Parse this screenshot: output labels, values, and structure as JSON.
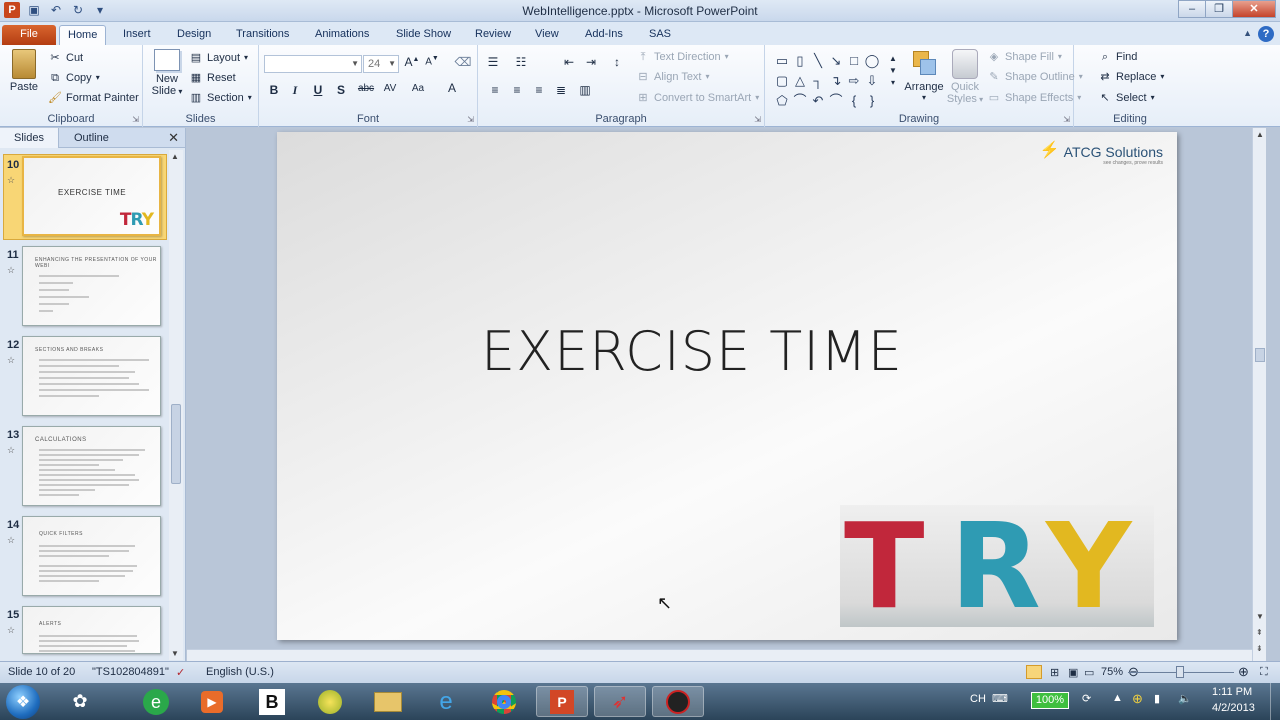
{
  "window": {
    "title": "WebIntelligence.pptx - Microsoft PowerPoint"
  },
  "tabs": [
    "File",
    "Home",
    "Insert",
    "Design",
    "Transitions",
    "Animations",
    "Slide Show",
    "Review",
    "View",
    "Add-Ins",
    "SAS"
  ],
  "ribbon": {
    "clipboard": {
      "paste": "Paste",
      "cut": "Cut",
      "copy": "Copy",
      "format_painter": "Format Painter",
      "label": "Clipboard"
    },
    "slides": {
      "new_slide": "New",
      "new_slide2": "Slide",
      "layout": "Layout",
      "reset": "Reset",
      "section": "Section",
      "label": "Slides"
    },
    "font": {
      "font_size": "24",
      "label": "Font"
    },
    "paragraph": {
      "text_direction": "Text Direction",
      "align_text": "Align Text",
      "convert": "Convert to SmartArt",
      "label": "Paragraph"
    },
    "drawing": {
      "arrange": "Arrange",
      "quick_styles": "Quick",
      "quick_styles2": "Styles",
      "shape_fill": "Shape Fill",
      "shape_outline": "Shape Outline",
      "shape_effects": "Shape Effects",
      "label": "Drawing"
    },
    "editing": {
      "find": "Find",
      "replace": "Replace",
      "select": "Select",
      "label": "Editing"
    }
  },
  "panel": {
    "tabs": [
      "Slides",
      "Outline"
    ],
    "slides": [
      {
        "num": "10",
        "title": "EXERCISE TIME"
      },
      {
        "num": "11",
        "title": "ENHANCING THE PRESENTATION OF YOUR WEBI"
      },
      {
        "num": "12",
        "title": "SECTIONS AND BREAKS"
      },
      {
        "num": "13",
        "title": "CALCULATIONS"
      },
      {
        "num": "14",
        "title": "QUICK FILTERS"
      },
      {
        "num": "15",
        "title": "ALERTS"
      }
    ]
  },
  "slide": {
    "heading": "EXERCISE TIME",
    "logo": "ATCG Solutions",
    "logo_tag": "see changes, prove results",
    "image_word": "TRY"
  },
  "status": {
    "slide_info": "Slide 10 of 20",
    "theme": "\"TS102804891\"",
    "language": "English (U.S.)",
    "zoom": "75%"
  },
  "taskbar": {
    "lang": "CH",
    "battery": "100%",
    "time": "1:11 PM",
    "date": "4/2/2013"
  },
  "colors": {
    "file_tab": "#c8461c",
    "selected_thumb": "#f8d675",
    "try_t": "#c1273b",
    "try_r": "#2f9bb3",
    "try_y": "#e2b820"
  }
}
